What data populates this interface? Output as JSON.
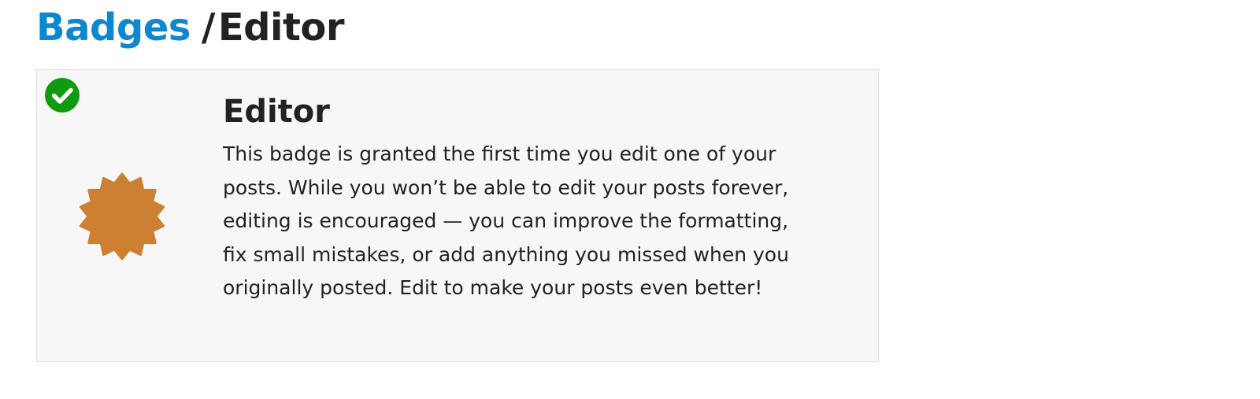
{
  "breadcrumb": {
    "parent_label": "Badges",
    "separator": "/",
    "current_label": "Editor"
  },
  "badge": {
    "name": "Editor",
    "description": "This badge is granted the first time you edit one of your posts. While you won’t be able to edit your posts forever, editing is encouraged — you can improve the formatting, fix small mistakes, or add anything you missed when you originally posted. Edit to make your posts even better!",
    "granted_icon": "check-circle-icon",
    "badge_icon": "starburst-badge-icon"
  },
  "colors": {
    "link": "#0d87cf",
    "text": "#222222",
    "card_background": "#f7f7f7",
    "card_border": "#dedede",
    "granted_green": "#109a10",
    "badge_bronze": "#cd7f32"
  }
}
